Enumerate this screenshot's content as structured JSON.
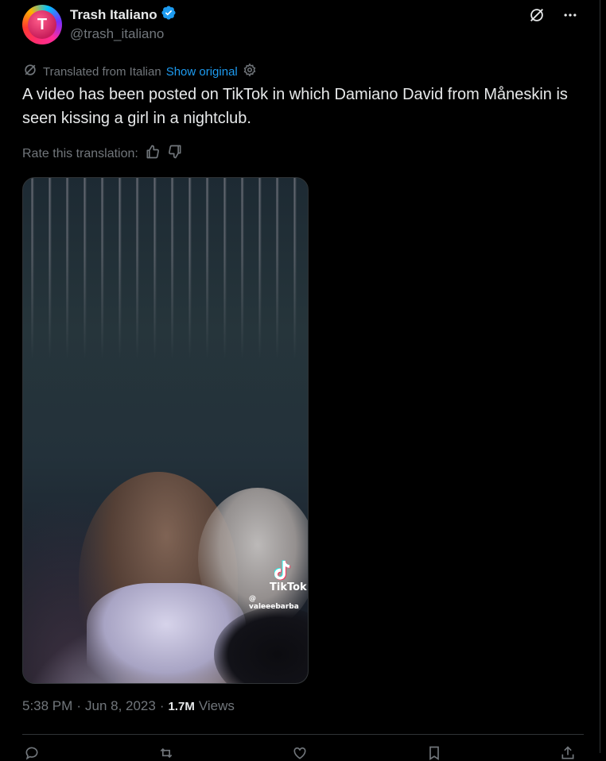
{
  "author": {
    "display_name": "Trash Italiano",
    "handle": "@trash_italiano",
    "verified": true,
    "avatar_letter": "T"
  },
  "translation": {
    "label": "Translated from Italian",
    "show_original": "Show original",
    "rate_label": "Rate this translation:"
  },
  "tweet": {
    "text": "A video has been posted on TikTok in which Damiano David from Måneskin is seen kissing a girl in a nightclub."
  },
  "media": {
    "watermark_brand": "TikTok",
    "watermark_user": "@ valeeebarba"
  },
  "meta": {
    "time": "5:38 PM",
    "separator": "·",
    "date": "Jun 8, 2023",
    "views_count": "1.7M",
    "views_label": "Views"
  },
  "colors": {
    "accent": "#1d9bf0",
    "text_primary": "#e7e9ea",
    "text_secondary": "#71767b",
    "background": "#000000",
    "border": "#2f3336"
  },
  "icons": {
    "verified": "verified-badge-icon",
    "grok": "grok-icon",
    "more": "more-icon",
    "translate": "translate-icon",
    "settings": "gear-icon",
    "thumbs_up": "thumbs-up-icon",
    "thumbs_down": "thumbs-down-icon"
  }
}
